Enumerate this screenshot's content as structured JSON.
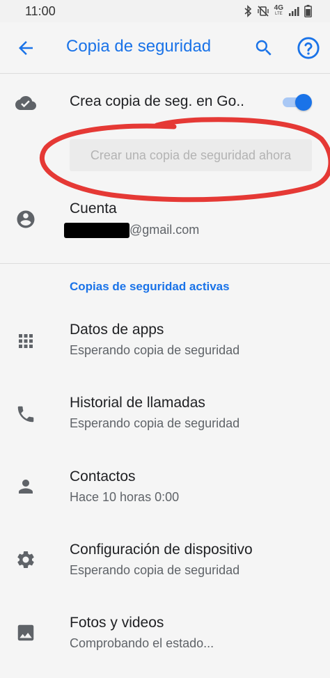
{
  "status_bar": {
    "time": "11:00",
    "network_label": "4G",
    "network_sub": "LTE",
    "icons": [
      "bluetooth-icon",
      "vibrate-mute-icon",
      "signal-icon",
      "battery-icon"
    ]
  },
  "app_bar": {
    "title": "Copia de seguridad",
    "icons": [
      "arrow-back-icon",
      "search-icon",
      "help-icon"
    ]
  },
  "backup": {
    "label": "Crea copia de seg. en Go..",
    "toggle_on": true,
    "button_label": "Crear una copia de seguridad ahora"
  },
  "account": {
    "label": "Cuenta",
    "email_suffix": "@gmail.com"
  },
  "section_header": "Copias de seguridad activas",
  "items": [
    {
      "icon": "apps-grid-icon",
      "title": "Datos de apps",
      "subtitle": "Esperando copia de seguridad"
    },
    {
      "icon": "phone-icon",
      "title": "Historial de llamadas",
      "subtitle": "Esperando copia de seguridad"
    },
    {
      "icon": "person-icon",
      "title": "Contactos",
      "subtitle": "Hace 10 horas 0:00"
    },
    {
      "icon": "gear-icon",
      "title": "Configuración de dispositivo",
      "subtitle": "Esperando copia de seguridad"
    },
    {
      "icon": "image-icon",
      "title": "Fotos y videos",
      "subtitle": "Comprobando el estado..."
    }
  ],
  "colors": {
    "accent": "#1a73e8",
    "annotation": "#e53935",
    "background": "#f5f5f5"
  }
}
